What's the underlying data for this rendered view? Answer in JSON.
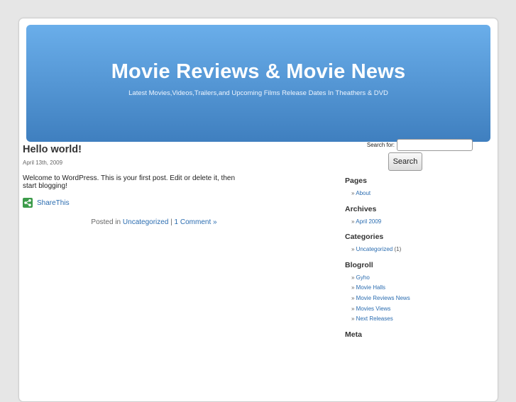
{
  "header": {
    "title": "Movie Reviews & Movie News",
    "description": "Latest Movies,Videos,Trailers,and Upcoming Films Release Dates In Theathers & DVD"
  },
  "post": {
    "title": "Hello world!",
    "date": "April 13th, 2009",
    "body": "Welcome to WordPress. This is your first post. Edit or delete it, then start blogging!",
    "share_label": "ShareThis",
    "meta_prefix": "Posted in ",
    "category": "Uncategorized",
    "separator": " | ",
    "comments": "1 Comment »"
  },
  "sidebar": {
    "search_label": "Search for:",
    "search_value": "",
    "search_button": "Search",
    "pages": {
      "title": "Pages",
      "items": [
        "About"
      ]
    },
    "archives": {
      "title": "Archives",
      "items": [
        "April 2009"
      ]
    },
    "categories": {
      "title": "Categories",
      "items": [
        {
          "label": "Uncategorized",
          "count": "(1)"
        }
      ]
    },
    "blogroll": {
      "title": "Blogroll",
      "items": [
        "Gyho",
        "Movie Halls",
        "Movie Reviews News",
        "Movies Views",
        "Next Releases"
      ]
    },
    "meta": {
      "title": "Meta"
    }
  },
  "colors": {
    "header_top": "#6aaeea",
    "header_bottom": "#3f7fbf",
    "link": "#2a6cb0",
    "share_icon": "#3c9b4a"
  }
}
